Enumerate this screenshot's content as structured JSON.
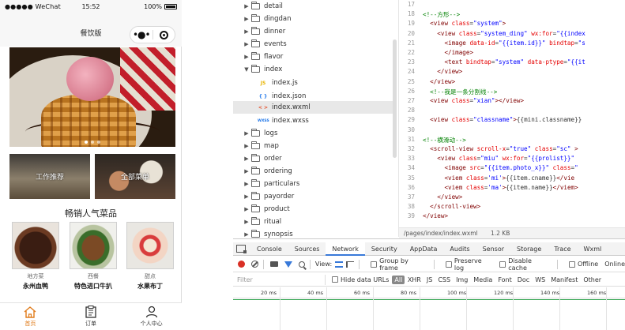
{
  "simulator": {
    "status": {
      "carrier": "●●●●● WeChat",
      "time": "15:52",
      "battery": "100%"
    },
    "nav_title": "餐饮版",
    "capsule_dots": "•●•",
    "entries": [
      {
        "label": "工作推荐"
      },
      {
        "label": "全部菜单"
      }
    ],
    "hot_title": "畅销人气菜品",
    "dishes": [
      {
        "cname": "地方菜",
        "name": "永州血鸭"
      },
      {
        "cname": "西餐",
        "name": "特色进口牛扒"
      },
      {
        "cname": "甜点",
        "name": "水果布丁"
      }
    ],
    "tabs": [
      {
        "label": "首页",
        "icon": "home-icon"
      },
      {
        "label": "订单",
        "icon": "order-icon"
      },
      {
        "label": "个人中心",
        "icon": "user-icon"
      }
    ]
  },
  "tree": {
    "folders_top": [
      "detail",
      "dingdan",
      "dinner",
      "events",
      "flavor"
    ],
    "open_folder": "index",
    "files": [
      {
        "name": "index.js",
        "type": "JS",
        "color": "#e8b400"
      },
      {
        "name": "index.json",
        "type": "{ }",
        "color": "#1a73e8"
      },
      {
        "name": "index.wxml",
        "type": "< >",
        "color": "#e5532f",
        "selected": true
      },
      {
        "name": "index.wxss",
        "type": "WXSS",
        "color": "#1a73e8"
      }
    ],
    "folders_bottom": [
      "logs",
      "map",
      "order",
      "ordering",
      "particulars",
      "payorder",
      "product",
      "ritual",
      "synopsis"
    ]
  },
  "editor": {
    "lines": [
      {
        "n": "17",
        "code": ""
      },
      {
        "n": "18",
        "code": "<!--方形-->"
      },
      {
        "n": "19",
        "code": "  <view class=\"system\">"
      },
      {
        "n": "20",
        "code": "    <view class=\"system_ding\" wx:for=\"{{index"
      },
      {
        "n": "21",
        "code": "      <image data-id=\"{{item.id}}\" bindtap=\"s"
      },
      {
        "n": "22",
        "code": "      </image>"
      },
      {
        "n": "23",
        "code": "      <text bindtap=\"system\" data-ptype=\"{{it"
      },
      {
        "n": "24",
        "code": "    </view>"
      },
      {
        "n": "25",
        "code": "  </view>"
      },
      {
        "n": "26",
        "code": "  <!--我是一条分割线-->"
      },
      {
        "n": "27",
        "code": "  <view class=\"xian\"></view>"
      },
      {
        "n": "28",
        "code": ""
      },
      {
        "n": "29",
        "code": "  <view class=\"classname\">{{mini.classname}}<"
      },
      {
        "n": "30",
        "code": ""
      },
      {
        "n": "31",
        "code": "<!--横滑动-->"
      },
      {
        "n": "32",
        "code": "  <scroll-view scroll-x=\"true\" class=\"sc\" >"
      },
      {
        "n": "33",
        "code": "    <view class=\"miu\" wx:for=\"{{prolist}}\" "
      },
      {
        "n": "34",
        "code": "      <image src=\"{{item.photo_x}}\" class=\""
      },
      {
        "n": "35",
        "code": "      <viem class='mi'>{{item.cname}}</vie"
      },
      {
        "n": "36",
        "code": "      <viem class='ma'>{{item.name}}</viem>"
      },
      {
        "n": "37",
        "code": "    </view>"
      },
      {
        "n": "38",
        "code": "  </scroll-view>"
      },
      {
        "n": "39",
        "code": "</view>"
      }
    ],
    "path": "/pages/index/index.wxml",
    "size": "1.2 KB"
  },
  "devtools": {
    "tabs": [
      "Console",
      "Sources",
      "Network",
      "Security",
      "AppData",
      "Audits",
      "Sensor",
      "Storage",
      "Trace",
      "Wxml"
    ],
    "active_tab": "Network",
    "view_label": "View:",
    "options": [
      "Group by frame",
      "Preserve log",
      "Disable cache",
      "Offline",
      "Online"
    ],
    "filter_placeholder": "Filter",
    "hide_urls": "Hide data URLs",
    "types": [
      "All",
      "XHR",
      "JS",
      "CSS",
      "Img",
      "Media",
      "Font",
      "Doc",
      "WS",
      "Manifest",
      "Other"
    ],
    "ticks": [
      "20 ms",
      "40 ms",
      "60 ms",
      "80 ms",
      "100 ms",
      "120 ms",
      "140 ms",
      "160 ms"
    ]
  },
  "colors": {
    "accent": "#e07b1a",
    "devtools_blue": "#3879d9",
    "record_red": "#d93025"
  }
}
